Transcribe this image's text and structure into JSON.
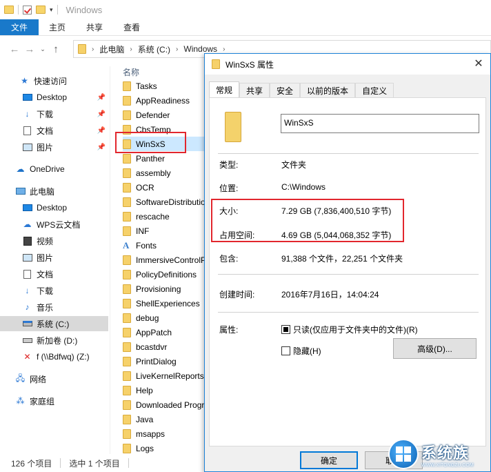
{
  "explorer": {
    "title": "Windows",
    "ribbon_tabs": [
      "文件",
      "主页",
      "共享",
      "查看"
    ],
    "address": [
      "此电脑",
      "系统 (C:)",
      "Windows"
    ],
    "sidebar": [
      {
        "label": "快速访问",
        "icon": "star-icon"
      },
      {
        "label": "Desktop",
        "icon": "desktop-icon",
        "pinned": true
      },
      {
        "label": "下载",
        "icon": "download-icon",
        "pinned": true
      },
      {
        "label": "文档",
        "icon": "document-icon",
        "pinned": true
      },
      {
        "label": "图片",
        "icon": "picture-icon",
        "pinned": true
      },
      {
        "label": "OneDrive",
        "icon": "cloud-icon"
      },
      {
        "label": "此电脑",
        "icon": "computer-icon"
      },
      {
        "label": "Desktop",
        "icon": "desktop-icon"
      },
      {
        "label": "WPS云文档",
        "icon": "wps-cloud-icon"
      },
      {
        "label": "视频",
        "icon": "video-icon"
      },
      {
        "label": "图片",
        "icon": "picture-icon"
      },
      {
        "label": "文档",
        "icon": "document-icon"
      },
      {
        "label": "下载",
        "icon": "download-icon"
      },
      {
        "label": "音乐",
        "icon": "music-icon"
      },
      {
        "label": "系统 (C:)",
        "icon": "drive-icon",
        "selected": true
      },
      {
        "label": "新加卷 (D:)",
        "icon": "drive-icon"
      },
      {
        "label": "f (\\\\Bdfwq) (Z:)",
        "icon": "network-drive-icon"
      },
      {
        "label": "网络",
        "icon": "network-icon"
      },
      {
        "label": "家庭组",
        "icon": "homegroup-icon"
      }
    ],
    "list_header": "名称",
    "files": [
      "Tasks",
      "AppReadiness",
      "Defender",
      "CbsTemp",
      "WinSxS",
      "Panther",
      "assembly",
      "OCR",
      "SoftwareDistribution",
      "rescache",
      "INF",
      "Fonts",
      "ImmersiveControlPanel",
      "PolicyDefinitions",
      "Provisioning",
      "ShellExperiences",
      "debug",
      "AppPatch",
      "bcastdvr",
      "PrintDialog",
      "LiveKernelReports",
      "Help",
      "Downloaded Program Files",
      "Java",
      "msapps",
      "Logs"
    ],
    "selected_file": "WinSxS",
    "status_count": "126 个项目",
    "status_selected": "选中 1 个项目"
  },
  "dialog": {
    "title": "WinSxS 属性",
    "tabs": [
      "常规",
      "共享",
      "安全",
      "以前的版本",
      "自定义"
    ],
    "name": "WinSxS",
    "type_label": "类型:",
    "type_value": "文件夹",
    "location_label": "位置:",
    "location_value": "C:\\Windows",
    "size_label": "大小:",
    "size_value": "7.29 GB (7,836,400,510 字节)",
    "disk_label": "占用空间:",
    "disk_value": "4.69 GB (5,044,068,352 字节)",
    "contains_label": "包含:",
    "contains_value": "91,388 个文件，22,251 个文件夹",
    "created_label": "创建时间:",
    "created_value": "2016年7月16日，14:04:24",
    "attr_label": "属性:",
    "readonly_label": "只读(仅应用于文件夹中的文件)(R)",
    "hidden_label": "隐藏(H)",
    "advanced_label": "高级(D)...",
    "ok_label": "确定",
    "cancel_label": "取消"
  },
  "watermark": {
    "name": "系统族",
    "url": "WWW.XITONGZU.COM"
  }
}
